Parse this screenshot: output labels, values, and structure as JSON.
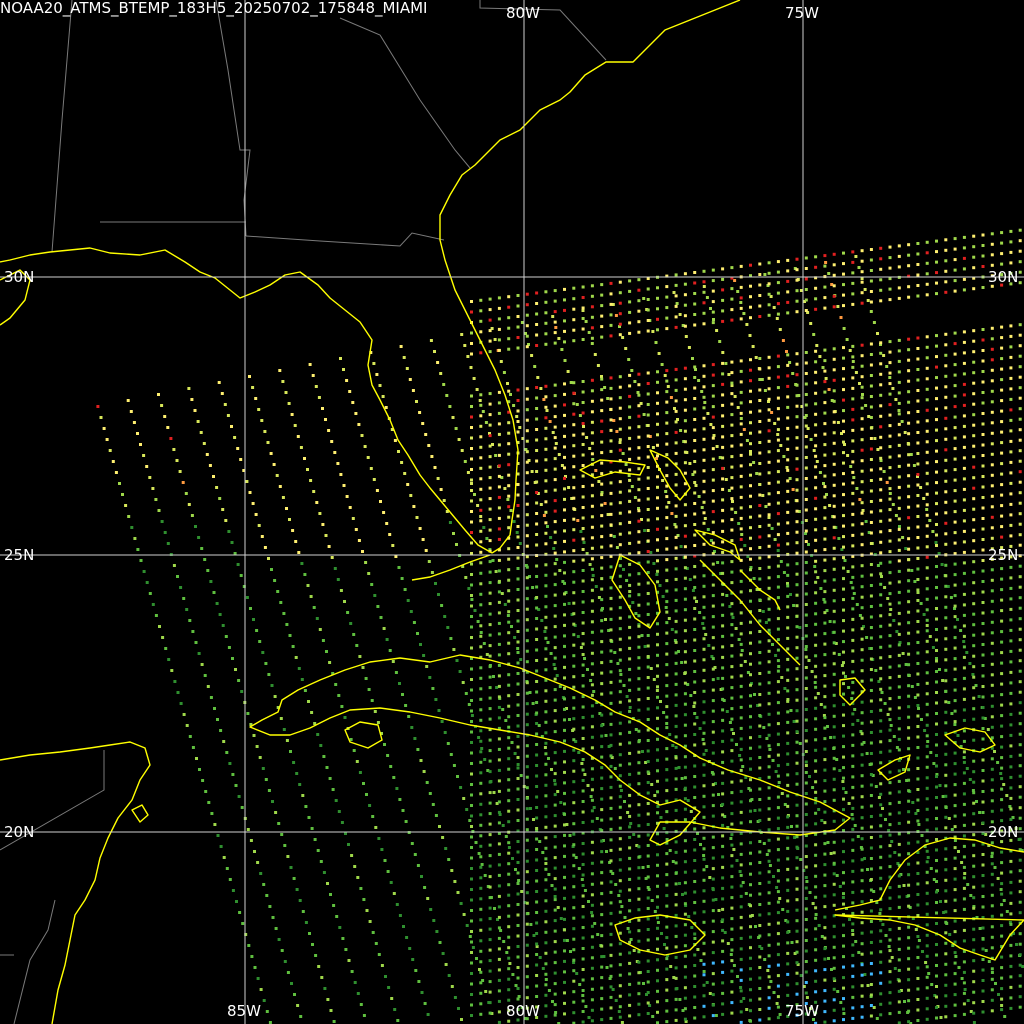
{
  "title": "NOAA20_ATMS_BTEMP_183H5_20250702_175848_MIAMI",
  "grid": {
    "lon_labels": [
      "85W",
      "80W",
      "75W"
    ],
    "lat_labels": [
      "30N",
      "25N",
      "20N"
    ],
    "top_lon_labels": [
      "80W",
      "75W"
    ],
    "right_lat_labels": [
      "30N",
      "25N",
      "20N"
    ]
  },
  "colors": {
    "background": "#000000",
    "coastline": "#ffff00",
    "borders": "#7a7a7a",
    "gridlines": "#d0d0d0",
    "label": "#ffffff",
    "palette": [
      "#2f8f2f",
      "#5fbf3f",
      "#9fd84a",
      "#d8e85a",
      "#ffef70",
      "#ff9a40",
      "#e02020",
      "#40b8ff"
    ]
  },
  "swath": {
    "sensor": "ATMS",
    "channel": "183H5",
    "satellite": "NOAA20"
  }
}
